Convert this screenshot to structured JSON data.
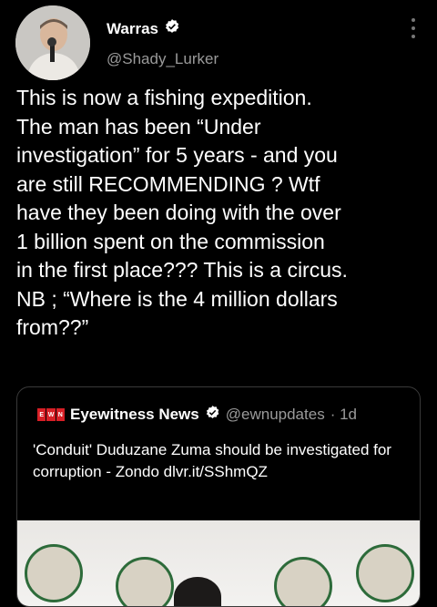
{
  "author": {
    "name": "Warras",
    "handle": "@Shady_Lurker",
    "verified_icon": "verified-badge-icon"
  },
  "tweet": {
    "text": "This is now a fishing expedition.\nThe man has been “Under\ninvestigation” for 5 years - and you\nare still RECOMMENDING ? Wtf\nhave they been doing with the over\n1 billion spent on the commission\nin the first place??? This is a circus.\nNB ; “Where is the 4 million dollars\nfrom??”"
  },
  "quoted": {
    "name": "Eyewitness News",
    "handle": "@ewnupdates",
    "time": "· 1d",
    "logo_letters": [
      "E",
      "W",
      "N"
    ],
    "text": "'Conduit' Duduzane Zuma should be investigated for corruption - Zondo dlvr.it/SShmQZ"
  },
  "colors": {
    "background": "#000000",
    "secondary_text": "#9a9a9a",
    "ewn_red": "#d71f26"
  }
}
